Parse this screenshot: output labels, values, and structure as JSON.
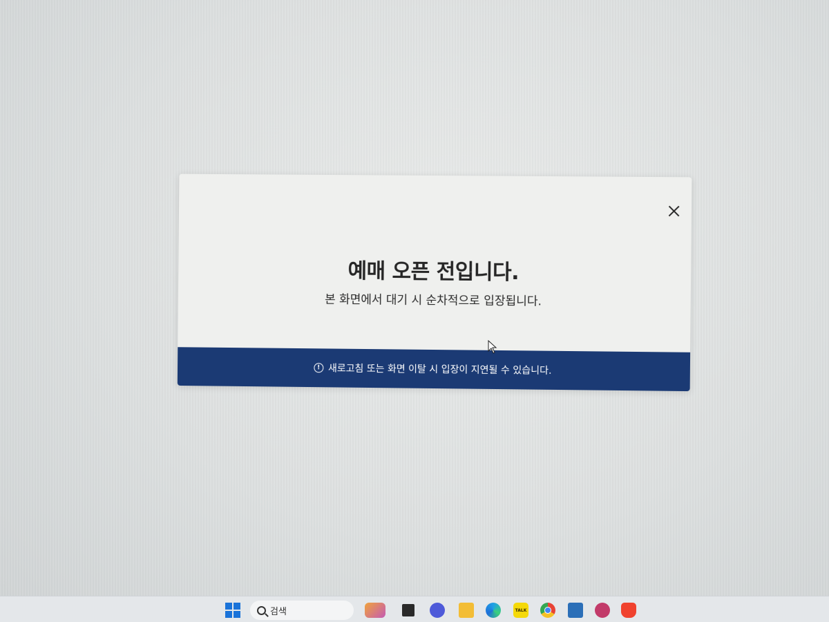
{
  "modal": {
    "title": "예매 오픈 전입니다.",
    "subtitle": "본 화면에서 대기 시 순차적으로 입장됩니다.",
    "notice": "새로고침 또는 화면 이탈 시 입장이 지연될 수 있습니다.",
    "close_icon": "close-icon",
    "notice_icon": "exclamation-circle-icon",
    "footer_color": "#1b3a74"
  },
  "taskbar": {
    "search_label": "검색",
    "icons": [
      "windows-start-icon",
      "search-icon",
      "widgets-icon",
      "task-view-icon",
      "chat-icon",
      "file-explorer-icon",
      "edge-icon",
      "kakaotalk-icon",
      "chrome-icon",
      "app-icon",
      "app-icon",
      "brave-icon"
    ],
    "kakao_label": "TALK"
  }
}
